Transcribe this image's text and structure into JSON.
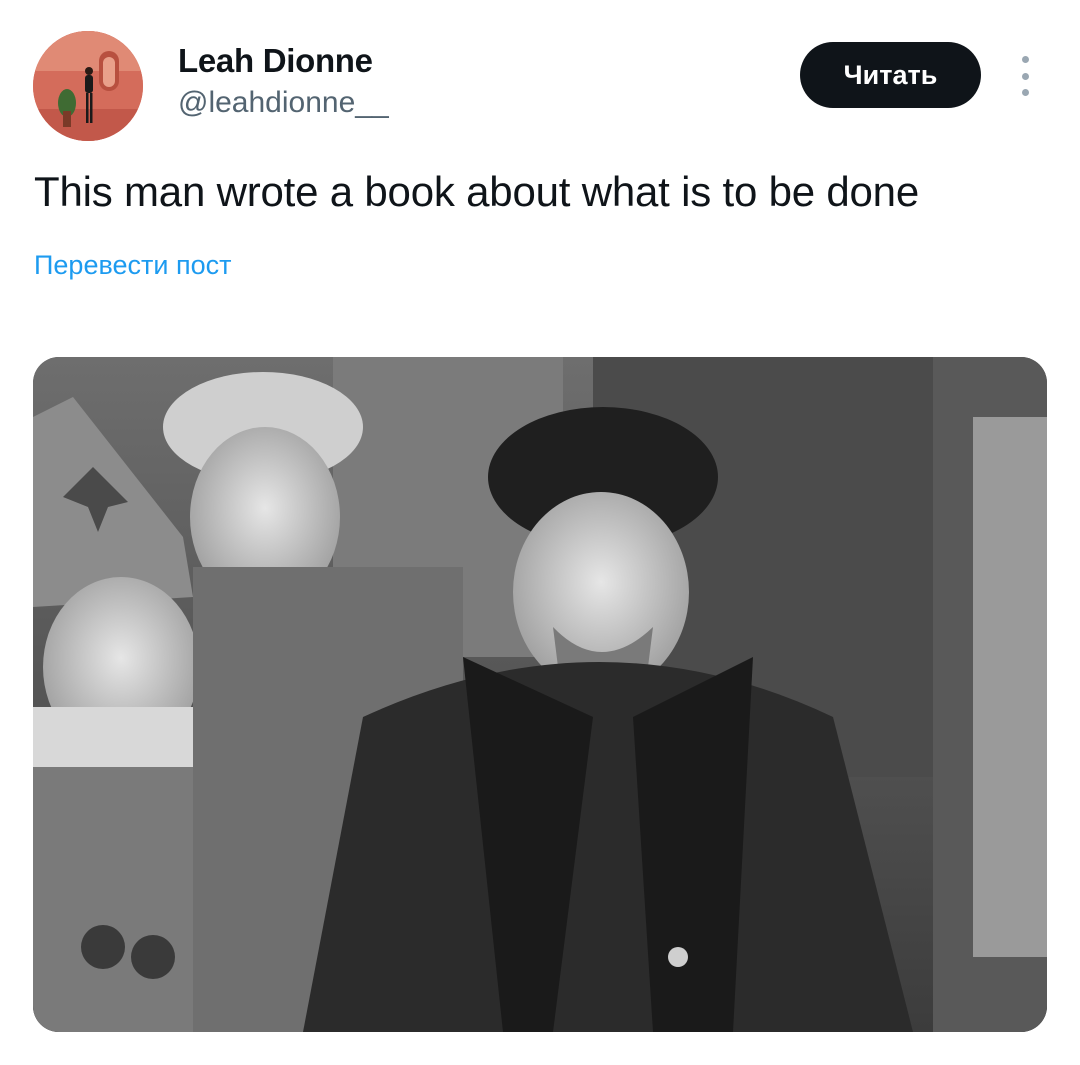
{
  "author": {
    "display_name": "Leah Dionne",
    "handle": "@leahdionne__",
    "avatar_icon": "profile-photo-avatar"
  },
  "actions": {
    "follow_label": "Читать",
    "more_icon": "more-vertical-icon"
  },
  "post": {
    "text": "This man wrote a book about what is to be done",
    "translate_label": "Перевести пост"
  },
  "media": {
    "type": "photo",
    "alt": "Black-and-white historical photograph of a group of men in winter coats and hats"
  },
  "colors": {
    "text_primary": "#0f1419",
    "text_secondary": "#536471",
    "link": "#1d9bf0",
    "button_bg": "#0f1419",
    "button_text": "#ffffff"
  }
}
